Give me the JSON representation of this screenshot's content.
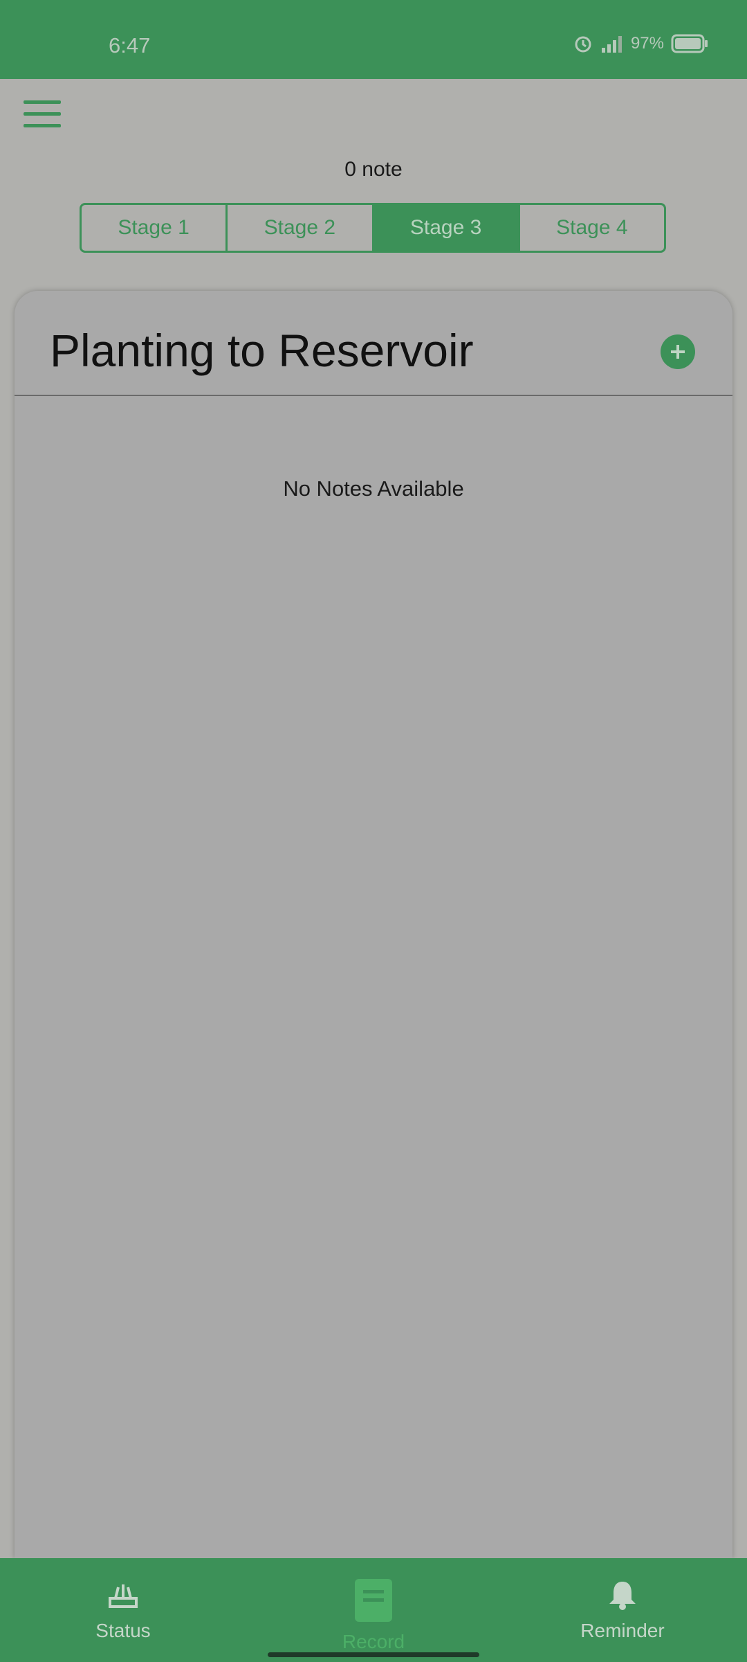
{
  "status_bar": {
    "time": "6:47",
    "battery": "97%"
  },
  "header": {
    "note_count": "0 note"
  },
  "stages": [
    {
      "label": "Stage 1",
      "active": false
    },
    {
      "label": "Stage 2",
      "active": false
    },
    {
      "label": "Stage 3",
      "active": true
    },
    {
      "label": "Stage 4",
      "active": false
    }
  ],
  "card": {
    "title": "Planting to Reservoir",
    "empty_message": "No Notes Available"
  },
  "bottom_nav": [
    {
      "label": "Status",
      "icon": "plant-icon",
      "active": false
    },
    {
      "label": "Record",
      "icon": "notebook-icon",
      "active": true
    },
    {
      "label": "Reminder",
      "icon": "bell-icon",
      "active": false
    }
  ],
  "colors": {
    "accent": "#3c9158",
    "overlay_bg": "#b0b0ad"
  }
}
